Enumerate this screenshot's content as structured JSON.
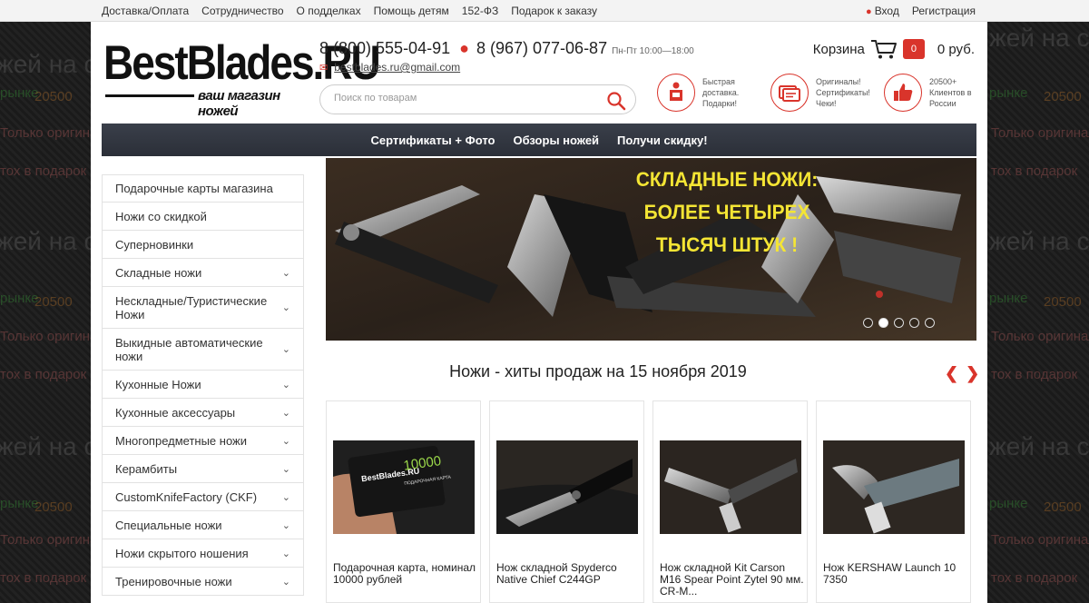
{
  "topbar": {
    "links": [
      "Доставка/Оплата",
      "Сотрудничество",
      "О подделках",
      "Помощь детям",
      "152-ФЗ",
      "Подарок к заказу"
    ],
    "login": "Вход",
    "register": "Регистрация"
  },
  "background": {
    "watermarks": [
      "жей на с",
      "Только оригинал",
      "рынке",
      "20500",
      "тох в подарок"
    ]
  },
  "header": {
    "logo_name": "BestBlades.RU",
    "logo_tagline": "ваш магазин ножей",
    "phone1": "8 (800) 555-04-91",
    "phone2": "8 (967) 077-06-87",
    "hours": "Пн-Пт 10:00—18:00",
    "email": "bestblades.ru@gmail.com",
    "search_placeholder": "Поиск по товарам",
    "cart_label": "Корзина",
    "cart_count": "0",
    "cart_sum": "0 руб.",
    "features": [
      {
        "icon": "delivery-icon",
        "text": "Быстрая доставка. Подарки!"
      },
      {
        "icon": "certificate-icon",
        "text": "Оригиналы! Сертификаты! Чеки!"
      },
      {
        "icon": "thumbs-up-icon",
        "text": "20500+ Клиентов в России"
      }
    ]
  },
  "nav": [
    "Сертификаты + Фото",
    "Обзоры ножей",
    "Получи скидку!"
  ],
  "sidebar": [
    {
      "label": "Подарочные карты магазина",
      "chev": false
    },
    {
      "label": "Ножи со скидкой",
      "chev": false
    },
    {
      "label": "Суперновинки",
      "chev": false
    },
    {
      "label": "Складные ножи",
      "chev": true
    },
    {
      "label": "Нескладные/Туристические Ножи",
      "chev": true
    },
    {
      "label": "Выкидные автоматические ножи",
      "chev": true
    },
    {
      "label": "Кухонные Ножи",
      "chev": true
    },
    {
      "label": "Кухонные аксессуары",
      "chev": true
    },
    {
      "label": "Многопредметные ножи",
      "chev": true
    },
    {
      "label": "Керамбиты",
      "chev": true
    },
    {
      "label": "CustomKnifeFactory (CKF)",
      "chev": true
    },
    {
      "label": "Специальные ножи",
      "chev": true
    },
    {
      "label": "Ножи скрытого ношения",
      "chev": true
    },
    {
      "label": "Тренировочные ножи",
      "chev": true
    }
  ],
  "banner": {
    "line1": "СКЛАДНЫЕ НОЖИ:",
    "line2": "БОЛЕЕ ЧЕТЫРЕХ ТЫСЯЧ ШТУК !",
    "slides": 5,
    "active_slide": 2
  },
  "hits": {
    "title": "Ножи - хиты продаж на 15 ноября 2019",
    "products": [
      {
        "name": "Подарочная карта, номинал 10000 рублей",
        "image": "gift-card"
      },
      {
        "name": "Нож складной Spyderco Native Chief C244GP",
        "image": "spyderco-knife"
      },
      {
        "name": "Нож складной Kit Carson M16 Spear Point Zytel 90 мм. CR-M...",
        "image": "kit-carson-knife"
      },
      {
        "name": "Нож KERSHAW Launch 10 7350",
        "image": "kershaw-knife"
      }
    ],
    "card_logo": "BestBlades.RU",
    "card_value": "10000",
    "card_caption": "ПОДАРОЧНАЯ КАРТА"
  },
  "colors": {
    "accent": "#d9342b",
    "nav_bg": "#2f333c",
    "banner_text": "#f4e534"
  }
}
